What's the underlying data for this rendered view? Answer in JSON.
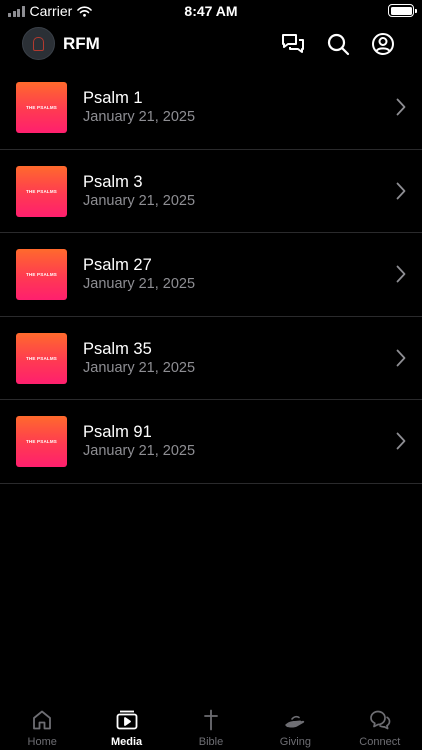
{
  "status_bar": {
    "carrier": "Carrier",
    "time": "8:47 AM",
    "battery_percent": 100
  },
  "header": {
    "title": "RFM"
  },
  "media_items": [
    {
      "title": "Psalm 1",
      "date": "January 21, 2025",
      "thumb_text": "THE PSALMS"
    },
    {
      "title": "Psalm 3",
      "date": "January 21, 2025",
      "thumb_text": "THE PSALMS"
    },
    {
      "title": "Psalm 27",
      "date": "January 21, 2025",
      "thumb_text": "THE PSALMS"
    },
    {
      "title": "Psalm 35",
      "date": "January 21, 2025",
      "thumb_text": "THE PSALMS"
    },
    {
      "title": "Psalm 91",
      "date": "January 21, 2025",
      "thumb_text": "THE PSALMS"
    }
  ],
  "tabs": [
    {
      "label": "Home",
      "icon": "home-icon",
      "active": false
    },
    {
      "label": "Media",
      "icon": "media-icon",
      "active": true
    },
    {
      "label": "Bible",
      "icon": "cross-icon",
      "active": false
    },
    {
      "label": "Giving",
      "icon": "giving-hand-icon",
      "active": false
    },
    {
      "label": "Connect",
      "icon": "chat-bubbles-icon",
      "active": false
    }
  ],
  "colors": {
    "background": "#000000",
    "text_primary": "#ffffff",
    "text_secondary": "#8e8e93",
    "tab_inactive": "#6e6e73",
    "thumb_gradient_top": "#ff6a2c",
    "thumb_gradient_bottom": "#ff1f6e"
  }
}
